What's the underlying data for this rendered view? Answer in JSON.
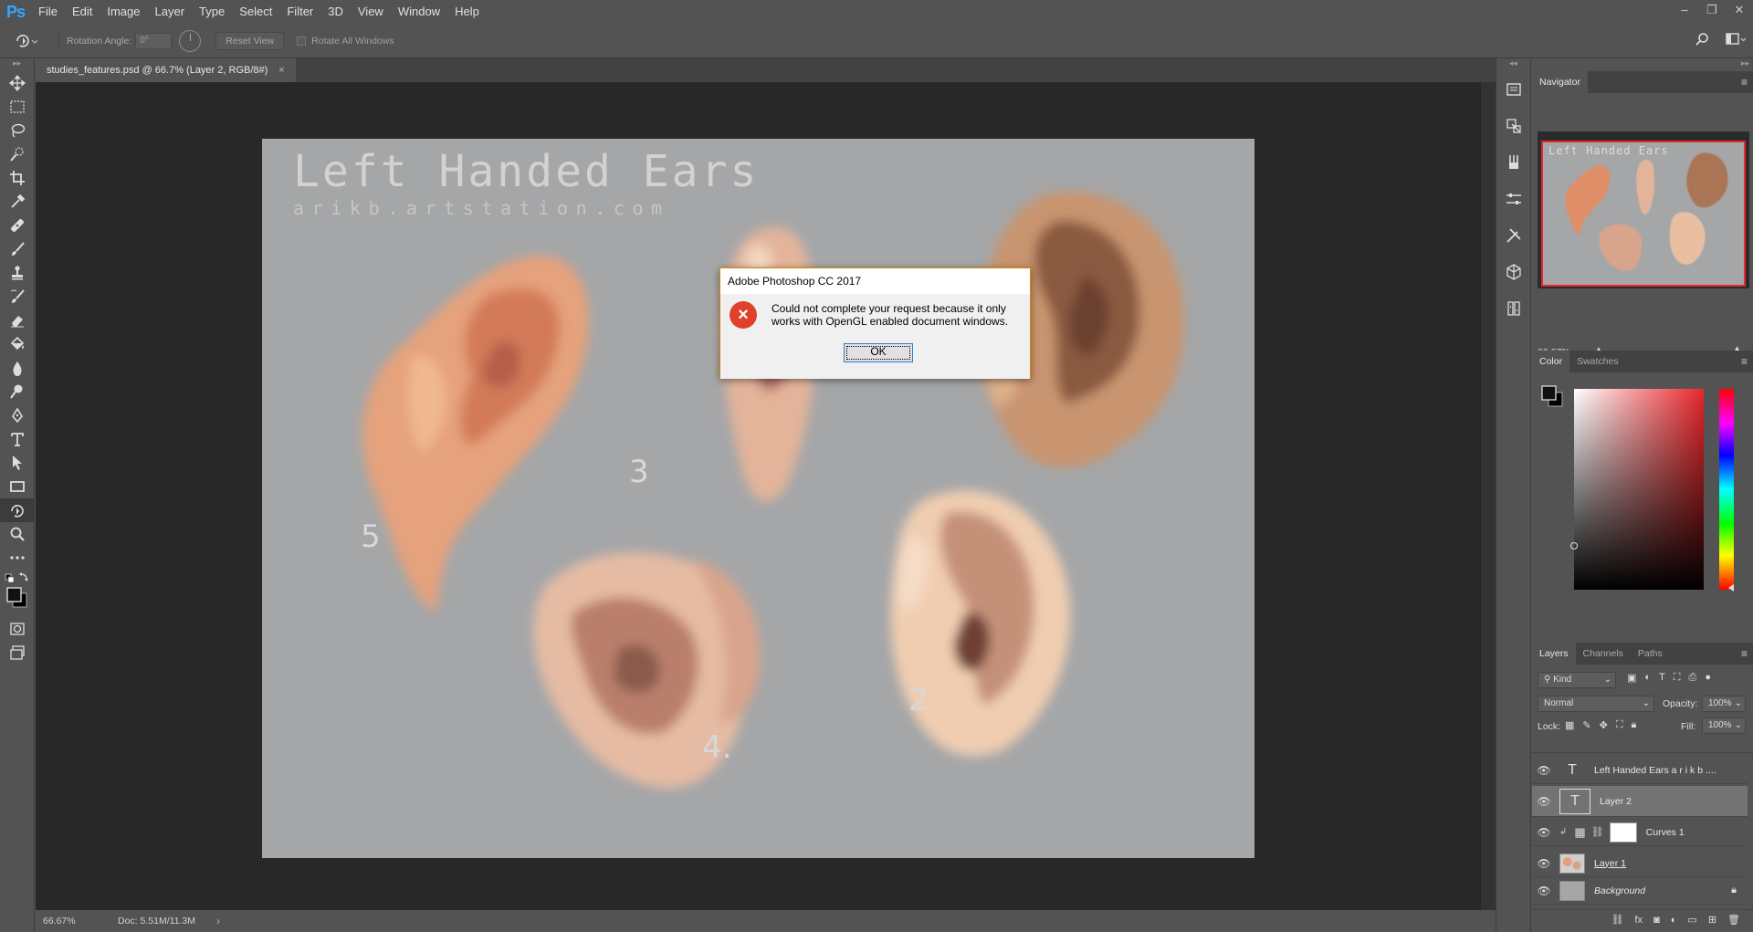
{
  "app": {
    "logo": "Ps"
  },
  "menu": [
    "File",
    "Edit",
    "Image",
    "Layer",
    "Type",
    "Select",
    "Filter",
    "3D",
    "View",
    "Window",
    "Help"
  ],
  "options": {
    "rotation_label": "Rotation Angle:",
    "rotation_value": "0°",
    "reset_view": "Reset View",
    "rotate_all": "Rotate All Windows"
  },
  "document": {
    "tab_title": "studies_features.psd @ 66.7% (Layer 2, RGB/8#)",
    "close": "×",
    "art_title": "Left Handed Ears",
    "art_url": "arikb.artstation.com",
    "ear_numbers": [
      "5",
      "3",
      "2",
      "4."
    ]
  },
  "status": {
    "zoom": "66.67%",
    "doc": "Doc: 5.51M/11.3M",
    "arrow": "›"
  },
  "dialog": {
    "title": "Adobe Photoshop CC 2017",
    "icon": "×",
    "message": "Could not complete your request because it only works with OpenGL enabled document windows.",
    "ok": "OK"
  },
  "navigator": {
    "tab": "Navigator",
    "zoom": "66.67%"
  },
  "color_panel": {
    "tabs": [
      "Color",
      "Swatches"
    ]
  },
  "layers_panel": {
    "tabs": [
      "Layers",
      "Channels",
      "Paths"
    ],
    "filter_kind": "Kind",
    "blend_mode": "Normal",
    "opacity_label": "Opacity:",
    "opacity": "100%",
    "lock_label": "Lock:",
    "fill_label": "Fill:",
    "fill": "100%",
    "layers": [
      {
        "name": "Left Handed Ears a r i k b ....",
        "thumb": "T"
      },
      {
        "name": "Layer 2",
        "thumb": "T"
      },
      {
        "name": "Curves 1",
        "thumb": ""
      },
      {
        "name": "Layer 1",
        "thumb": ""
      },
      {
        "name": "Background",
        "thumb": ""
      }
    ]
  },
  "colors": {
    "accent_red": "#e8262b",
    "ps_blue": "#31a8ff",
    "dialog_border": "#d48a00"
  }
}
